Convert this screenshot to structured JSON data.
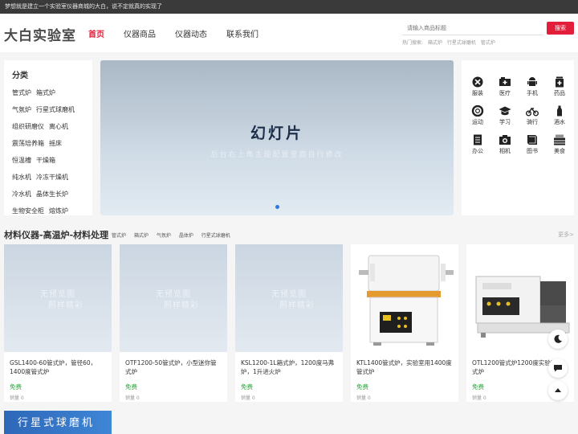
{
  "topbar": {
    "text": "梦想就是建立一个实验室仪器商城的大白，说不定就真的实现了"
  },
  "header": {
    "logo": "大白实验室",
    "nav": [
      {
        "label": "首页",
        "active": true
      },
      {
        "label": "仪器商品",
        "active": false
      },
      {
        "label": "仪器动态",
        "active": false
      },
      {
        "label": "联系我们",
        "active": false
      }
    ],
    "search": {
      "placeholder": "请输入商品标题",
      "button": "搜索",
      "hot_label": "热门搜索:",
      "hot_items": [
        "箱式炉",
        "行星式球磨机",
        "管式炉"
      ]
    }
  },
  "categories": {
    "title": "分类",
    "rows": [
      [
        "管式炉",
        "箱式炉"
      ],
      [
        "气氛炉",
        "行星式球磨机"
      ],
      [
        "组织研磨仪",
        "离心机"
      ],
      [
        "震荡培养箱",
        "摇床"
      ],
      [
        "恒温槽",
        "干燥箱"
      ],
      [
        "纯水机",
        "冷冻干燥机"
      ],
      [
        "冷水机",
        "晶体生长炉"
      ],
      [
        "生物安全柜",
        "熔炼炉"
      ]
    ]
  },
  "slider": {
    "title": "幻灯片",
    "subtitle": "后台右上角主题配置里面自行修改"
  },
  "quick_icons": [
    {
      "label": "服装",
      "icon": "clothes-icon"
    },
    {
      "label": "医疗",
      "icon": "medical-icon"
    },
    {
      "label": "手机",
      "icon": "phone-icon"
    },
    {
      "label": "药品",
      "icon": "medicine-icon"
    },
    {
      "label": "运动",
      "icon": "sport-icon"
    },
    {
      "label": "学习",
      "icon": "study-icon"
    },
    {
      "label": "骑行",
      "icon": "cycling-icon"
    },
    {
      "label": "酒水",
      "icon": "drinks-icon"
    },
    {
      "label": "办公",
      "icon": "office-icon"
    },
    {
      "label": "相机",
      "icon": "camera-icon"
    },
    {
      "label": "图书",
      "icon": "books-icon"
    },
    {
      "label": "美食",
      "icon": "food-icon"
    }
  ],
  "section": {
    "title": "材料仪器-高温炉-材料处理",
    "tags": [
      "管式炉",
      "箱式炉",
      "气氛炉",
      "晶体炉",
      "行星式球磨机"
    ],
    "more": "更多>"
  },
  "products": [
    {
      "name": "GSL1400-60管式炉，管径60，1400度管式炉",
      "price": "免费",
      "sales": "销量 0",
      "placeholder_line1": "无预览图",
      "placeholder_line2": "照样精彩"
    },
    {
      "name": "OTF1200-50管式炉，小型迷你管式炉",
      "price": "免费",
      "sales": "销量 0",
      "placeholder_line1": "无预览图",
      "placeholder_line2": "照样精彩"
    },
    {
      "name": "KSL1200-1L箱式炉，1200度马弗炉，1升进火炉",
      "price": "免费",
      "sales": "销量 0",
      "placeholder_line1": "无预览图",
      "placeholder_line2": "照样精彩"
    },
    {
      "name": "KTL1400管式炉，实验室用1400度管式炉",
      "price": "免费",
      "sales": "销量 0"
    },
    {
      "name": "OTL1200管式炉1200度实验室管式炉",
      "price": "免费",
      "sales": "销量 0"
    }
  ],
  "bottom_banner": {
    "text": "行星式球磨机"
  }
}
